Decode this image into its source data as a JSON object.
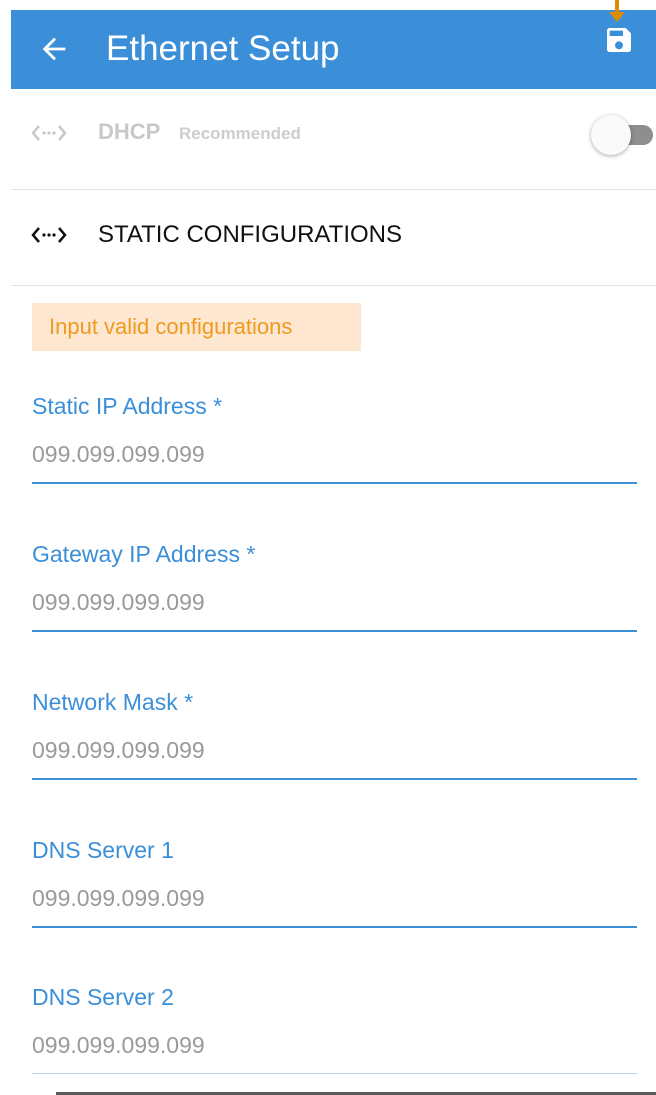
{
  "colors": {
    "appbar": "#3a8fd8",
    "accent": "#3a8fd8",
    "warning_bg": "#fde7d0",
    "warning_text": "#f09a1e",
    "pointer": "#e08a00"
  },
  "appbar": {
    "title": "Ethernet Setup",
    "back_icon": "arrow-left-icon",
    "save_icon": "floppy-disk-icon"
  },
  "dhcp": {
    "icon": "ethernet-icon",
    "label": "DHCP",
    "sublabel": "Recommended",
    "enabled": false
  },
  "static": {
    "icon": "ethernet-icon",
    "label": "STATIC CONFIGURATIONS"
  },
  "warning": {
    "text": "Input valid configurations"
  },
  "fields": [
    {
      "label": "Static IP Address *",
      "placeholder": "099.099.099.099",
      "value": ""
    },
    {
      "label": "Gateway IP Address *",
      "placeholder": "099.099.099.099",
      "value": ""
    },
    {
      "label": "Network Mask *",
      "placeholder": "099.099.099.099",
      "value": ""
    },
    {
      "label": "DNS Server 1",
      "placeholder": "099.099.099.099",
      "value": ""
    },
    {
      "label": "DNS Server 2",
      "placeholder": "099.099.099.099",
      "value": ""
    }
  ]
}
